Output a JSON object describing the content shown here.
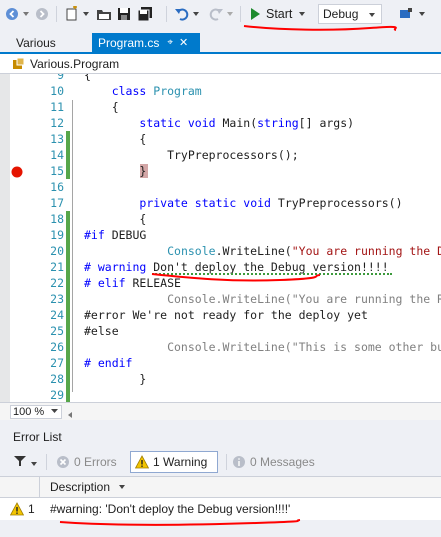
{
  "toolbar": {
    "start_label": "Start",
    "config_value": "Debug"
  },
  "tabs": [
    {
      "label": "Various",
      "active": false
    },
    {
      "label": "Program.cs",
      "active": true
    }
  ],
  "navbar": {
    "scope": "Various.Program"
  },
  "editor": {
    "zoom": "100 %",
    "lines": [
      {
        "n": "9",
        "code": "{",
        "chg": ""
      },
      {
        "n": "10",
        "code": "    class Program",
        "chg": ""
      },
      {
        "n": "11",
        "code": "    {",
        "chg": ""
      },
      {
        "n": "12",
        "code": "        static void Main(string[] args)",
        "chg": ""
      },
      {
        "n": "13",
        "code": "        {",
        "chg": "green"
      },
      {
        "n": "14",
        "code": "            TryPreprocessors();",
        "chg": "green"
      },
      {
        "n": "15",
        "code": "        }",
        "chg": "green"
      },
      {
        "n": "16",
        "code": "",
        "chg": ""
      },
      {
        "n": "17",
        "code": "        private static void TryPreprocessors()",
        "chg": ""
      },
      {
        "n": "18",
        "code": "        {",
        "chg": "green"
      },
      {
        "n": "19",
        "code": "#if DEBUG",
        "chg": "green"
      },
      {
        "n": "20",
        "code": "            Console.WriteLine(\"You are running the Debug build\");",
        "chg": "green"
      },
      {
        "n": "21",
        "code": "# warning Don't deploy the Debug version!!!!",
        "chg": "green"
      },
      {
        "n": "22",
        "code": "# elif RELEASE",
        "chg": "green"
      },
      {
        "n": "23",
        "code": "            Console.WriteLine(\"You are running the Release build\");",
        "chg": "green"
      },
      {
        "n": "24",
        "code": "#error We're not ready for the deploy yet",
        "chg": "green"
      },
      {
        "n": "25",
        "code": "#else",
        "chg": "green"
      },
      {
        "n": "26",
        "code": "            Console.WriteLine(\"This is some other build\");",
        "chg": "green"
      },
      {
        "n": "27",
        "code": "# endif",
        "chg": "green"
      },
      {
        "n": "28",
        "code": "        }",
        "chg": "green"
      },
      {
        "n": "29",
        "code": "",
        "chg": "green"
      }
    ]
  },
  "error_list": {
    "title": "Error List",
    "errors_label": "0 Errors",
    "warnings_label": "1 Warning",
    "messages_label": "0 Messages",
    "column_description": "Description",
    "row": {
      "index": "1",
      "description": "#warning: 'Don't deploy the Debug version!!!!'"
    }
  },
  "colors": {
    "accent": "#007acc",
    "keyword": "#0000ff",
    "type": "#2b91af",
    "string": "#a31515",
    "breakpoint": "#e51400",
    "change_bar": "#57a64a",
    "annotation": "#ff0000"
  }
}
